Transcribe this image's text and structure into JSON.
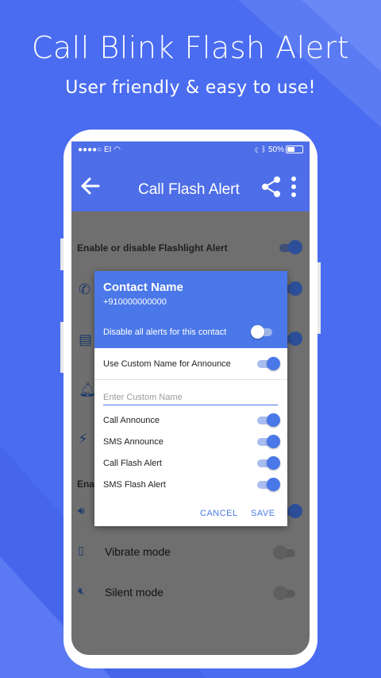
{
  "promo": {
    "title": "Call Blink Flash Alert",
    "subtitle": "User friendly & easy to use!"
  },
  "status_bar": {
    "carrier": "●●●●○ EI",
    "battery": "50%"
  },
  "app_bar": {
    "title": "Call Flash Alert",
    "icons": [
      "back-arrow-icon",
      "share-icon",
      "more-vert-icon"
    ]
  },
  "background": {
    "enable_label": "Enable or disable Flashlight Alert",
    "section_partial": "Ena",
    "vibrate_label": "Vibrate mode",
    "silent_label": "Silent mode"
  },
  "dialog": {
    "contact_name": "Contact Name",
    "phone": "+910000000000",
    "disable_label": "Disable all alerts for this contact",
    "disable_on": false,
    "custom_name_label": "Use Custom Name for Announce",
    "custom_name_on": true,
    "custom_name_placeholder": "Enter Custom Name",
    "options": [
      {
        "label": "Call Announce",
        "on": true
      },
      {
        "label": "SMS Announce",
        "on": true
      },
      {
        "label": "Call Flash Alert",
        "on": true
      },
      {
        "label": "SMS Flash Alert",
        "on": true
      }
    ],
    "cancel": "CANCEL",
    "save": "SAVE"
  },
  "colors": {
    "brand": "#4a6cf0",
    "accent": "#4b78e8"
  }
}
